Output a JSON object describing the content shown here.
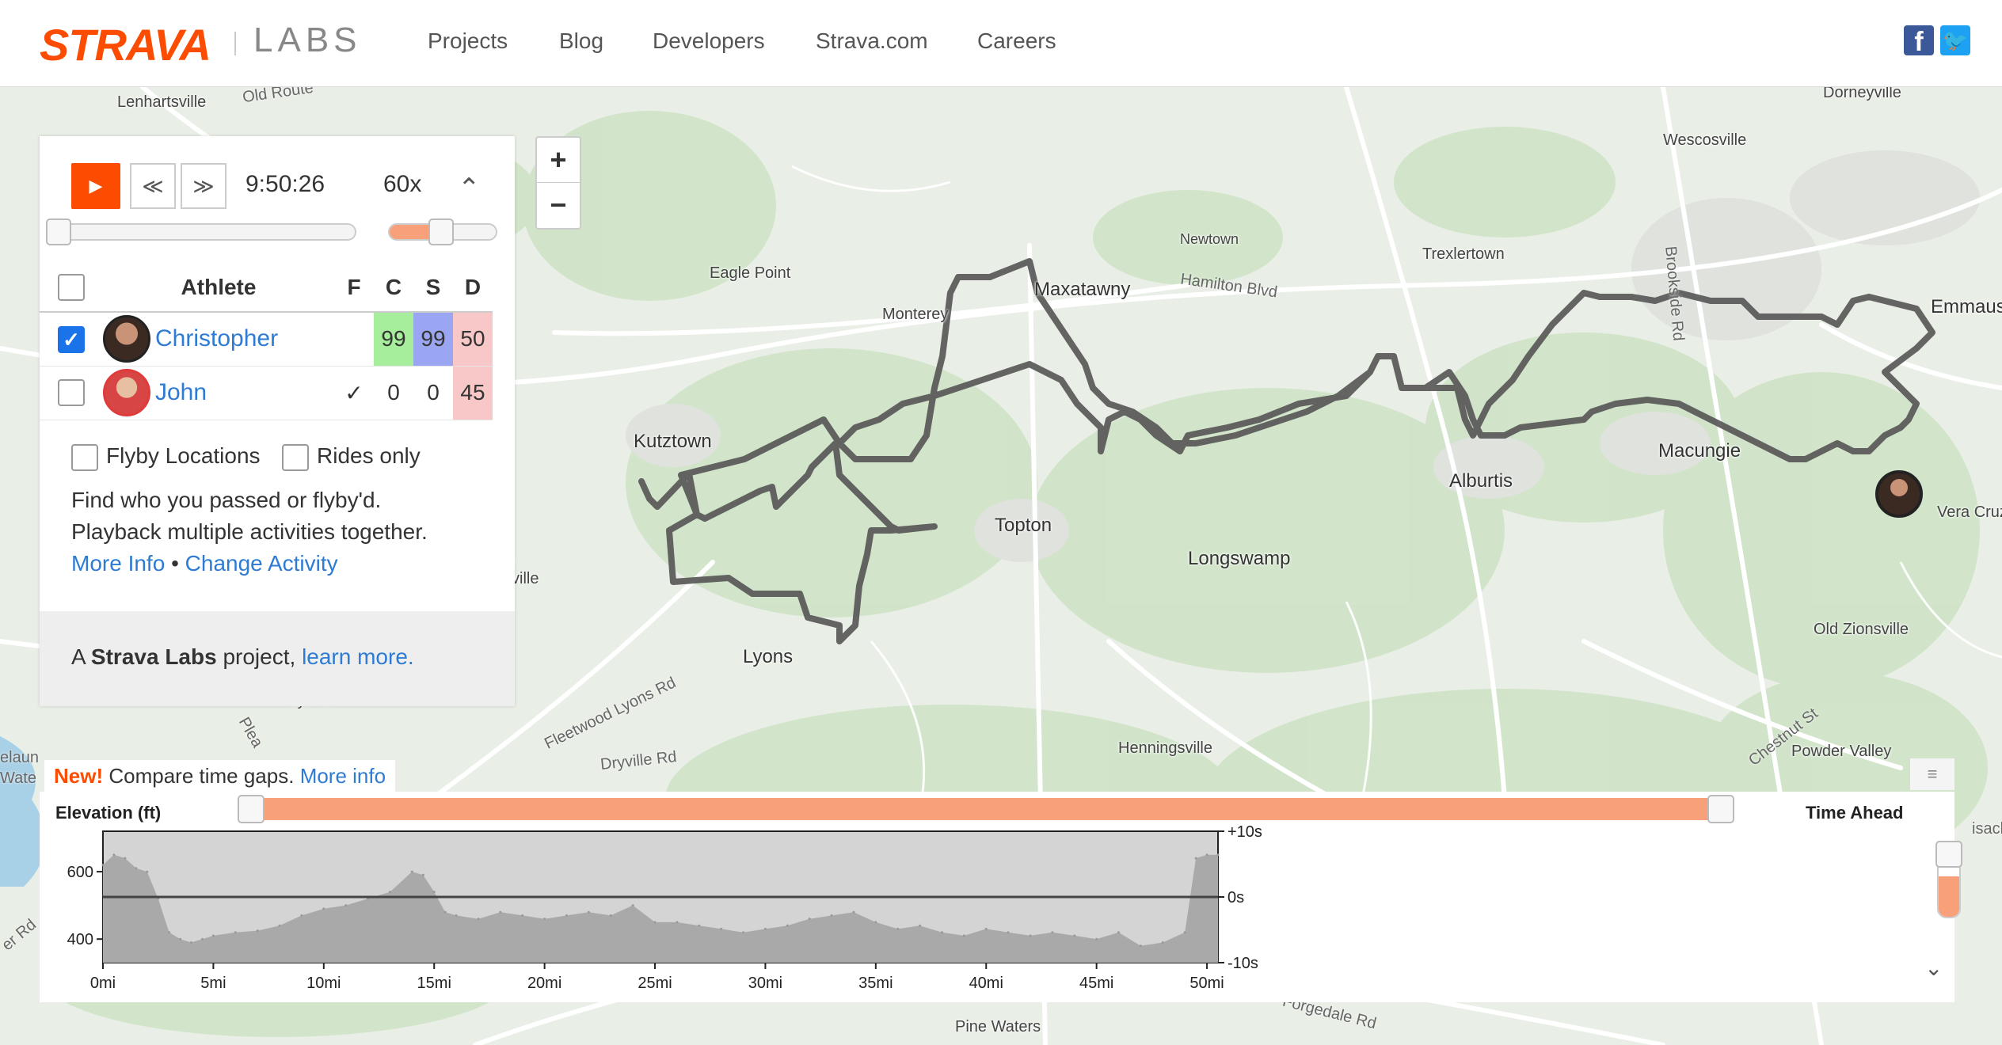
{
  "header": {
    "logo": "STRAVA",
    "labs": "LABS",
    "nav": [
      "Projects",
      "Blog",
      "Developers",
      "Strava.com",
      "Careers"
    ],
    "social": {
      "facebook_glyph": "f",
      "twitter_glyph": "🐦"
    }
  },
  "map": {
    "zoom_in": "+",
    "zoom_out": "−",
    "places": [
      "Lenhartsville",
      "Dorneyville",
      "Wescosville",
      "Newtown",
      "Trexlertown",
      "Emmaus",
      "Eagle Point",
      "Maxatawny",
      "Monterey",
      "Kutztown",
      "Topton",
      "Longswamp",
      "Alburtis",
      "Macungie",
      "Vera Cruz",
      "Lyons",
      "Old Zionsville",
      "Henningsville",
      "Powder Valley",
      "Pine Waters",
      "Kirbyville",
      "ville"
    ],
    "roads": [
      "Old Route",
      "Hamilton Blvd",
      "Brookside Rd",
      "Fleetwood Lyons Rd",
      "Dryville Rd",
      "Chestnut St",
      "Forgedale Rd",
      "Plea",
      "er Rd",
      "Wate",
      "elaun",
      "isach"
    ],
    "route_color": "#555555"
  },
  "playback": {
    "play_glyph": "▶",
    "rewind_glyph": "≪",
    "forward_glyph": "≫",
    "clock": "9:50:26",
    "speed": "60x",
    "collapse_glyph": "⌃",
    "time_position": 0.02,
    "speed_position": 0.45
  },
  "table": {
    "headers": {
      "athlete": "Athlete",
      "f": "F",
      "c": "C",
      "s": "S",
      "d": "D"
    },
    "rows": [
      {
        "name": "Christopher",
        "checked": true,
        "f": "",
        "c": "99",
        "s": "99",
        "d": "50"
      },
      {
        "name": "John",
        "checked": false,
        "f": "✓",
        "c": "0",
        "s": "0",
        "d": "45"
      }
    ]
  },
  "options": {
    "flyby": "Flyby Locations",
    "rides": "Rides only"
  },
  "info": {
    "line1": "Find who you passed or flyby'd.",
    "line2": "Playback multiple activities together.",
    "more_info": "More Info",
    "sep": "•",
    "change_activity": "Change Activity"
  },
  "footer": {
    "prefix": "A ",
    "brand": "Strava Labs",
    "mid": " project, ",
    "link": "learn more."
  },
  "banner": {
    "new": "New!",
    "text": " Compare time gaps. ",
    "link": "More info"
  },
  "chart": {
    "elevation_label": "Elevation (ft)",
    "time_ahead_label": "Time Ahead",
    "toggle_glyph": "≡",
    "expand_glyph": "⌄",
    "y_ticks": [
      "600",
      "400"
    ],
    "right_ticks": [
      "+10s",
      "0s",
      "-10s"
    ],
    "x_ticks": [
      "0mi",
      "5mi",
      "10mi",
      "15mi",
      "20mi",
      "25mi",
      "30mi",
      "35mi",
      "40mi",
      "45mi",
      "50mi"
    ],
    "time_ahead_level": 0.55
  },
  "chart_data": {
    "type": "area",
    "title": "",
    "xlabel": "",
    "ylabel": "Elevation (ft)",
    "xlim": [
      0,
      50.5
    ],
    "ylim": [
      330,
      720
    ],
    "y2label": "Time Ahead",
    "y2lim": [
      -10,
      10
    ],
    "series": [
      {
        "x": [
          0,
          0.5,
          1,
          1.5,
          2,
          2.5,
          3,
          3.5,
          4,
          4.5,
          5,
          6,
          7,
          8,
          9,
          10,
          11,
          12,
          13,
          14,
          14.5,
          15,
          15.5,
          16,
          17,
          18,
          19,
          20,
          21,
          22,
          23,
          24,
          25,
          26,
          27,
          28,
          29,
          30,
          31,
          32,
          33,
          34,
          35,
          36,
          37,
          38,
          39,
          40,
          41,
          42,
          43,
          44,
          45,
          46,
          47,
          48,
          49,
          49.5,
          50,
          50.5
        ],
        "y": [
          620,
          650,
          640,
          610,
          600,
          520,
          420,
          400,
          390,
          400,
          410,
          420,
          425,
          440,
          470,
          490,
          500,
          520,
          540,
          600,
          590,
          540,
          480,
          470,
          460,
          480,
          470,
          460,
          470,
          480,
          470,
          500,
          450,
          450,
          440,
          430,
          420,
          430,
          440,
          460,
          470,
          480,
          450,
          430,
          440,
          420,
          410,
          430,
          420,
          410,
          420,
          410,
          400,
          420,
          380,
          390,
          420,
          640,
          650,
          650
        ]
      },
      {
        "x": [
          0,
          50.5
        ],
        "y": [
          0,
          0
        ]
      }
    ],
    "grid": false
  }
}
